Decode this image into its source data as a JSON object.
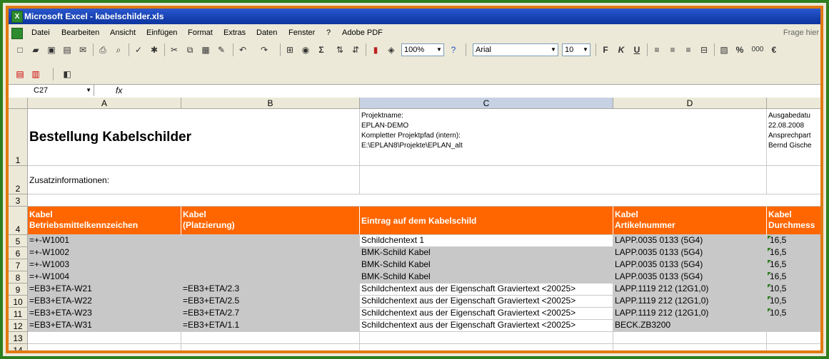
{
  "window": {
    "title": "Microsoft Excel - kabelschilder.xls",
    "app_icon": "X"
  },
  "menu": {
    "items": [
      "Datei",
      "Bearbeiten",
      "Ansicht",
      "Einfügen",
      "Format",
      "Extras",
      "Daten",
      "Fenster",
      "?",
      "Adobe PDF"
    ],
    "ask_placeholder": "Frage hier"
  },
  "toolbar": {
    "zoom": "100%",
    "font": "Arial",
    "size": "10",
    "bold": "F",
    "italic": "K",
    "underline": "U",
    "percent": "%",
    "thousands": "000",
    "euro": "€",
    "sum": "Σ"
  },
  "formula_bar": {
    "name_box": "C27",
    "fx": "fx"
  },
  "columns": [
    "A",
    "B",
    "C",
    "D"
  ],
  "rows": [
    "1",
    "2",
    "3",
    "4",
    "5",
    "6",
    "7",
    "8",
    "9",
    "10",
    "11",
    "12",
    "13",
    "14"
  ],
  "sheet": {
    "title": "Bestellung Kabelschilder",
    "project_info": [
      "Projektname:",
      "EPLAN-DEMO",
      "Kompletter Projektpfad (intern):",
      "E:\\EPLAN8\\Projekte\\EPLAN_alt"
    ],
    "issue_info": [
      "Ausgabedatu",
      "22.08.2008",
      "Ansprechpart",
      "Bernd Gische"
    ],
    "zusatz_label": "Zusatzinformationen:",
    "headers": {
      "a1": "Kabel",
      "a2": "Betriebsmittelkennzeichen",
      "b1": "Kabel",
      "b2": "(Platzierung)",
      "c1": "Eintrag auf dem Kabelschild",
      "d1": "Kabel",
      "d2": "Artikelnummer",
      "e1": "Kabel",
      "e2": "Durchmess"
    },
    "data_rows": [
      {
        "a": "=+-W1001",
        "b": "",
        "c": "Schildchentext 1",
        "d": "LAPP.0035 0133 (5G4)",
        "e": "16,5"
      },
      {
        "a": "=+-W1002",
        "b": "",
        "c": "BMK-Schild Kabel",
        "d": "LAPP.0035 0133 (5G4)",
        "e": "16,5"
      },
      {
        "a": "=+-W1003",
        "b": "",
        "c": "BMK-Schild Kabel",
        "d": "LAPP.0035 0133 (5G4)",
        "e": "16,5"
      },
      {
        "a": "=+-W1004",
        "b": "",
        "c": "BMK-Schild Kabel",
        "d": "LAPP.0035 0133 (5G4)",
        "e": "16,5"
      },
      {
        "a": "=EB3+ETA-W21",
        "b": "=EB3+ETA/2.3",
        "c": "Schildchentext aus der Eigenschaft Graviertext <20025>",
        "d": "LAPP.1119 212 (12G1,0)",
        "e": "10,5"
      },
      {
        "a": "=EB3+ETA-W22",
        "b": "=EB3+ETA/2.5",
        "c": "Schildchentext aus der Eigenschaft Graviertext <20025>",
        "d": "LAPP.1119 212 (12G1,0)",
        "e": "10,5"
      },
      {
        "a": "=EB3+ETA-W23",
        "b": "=EB3+ETA/2.7",
        "c": "Schildchentext aus der Eigenschaft Graviertext <20025>",
        "d": "LAPP.1119 212 (12G1,0)",
        "e": "10,5"
      },
      {
        "a": "=EB3+ETA-W31",
        "b": "=EB3+ETA/1.1",
        "c": "Schildchentext aus der Eigenschaft Graviertext <20025>",
        "d": "BECK.ZB3200",
        "e": ""
      }
    ]
  },
  "colors": {
    "header_orange": "#ff6600",
    "row_gray": "#c8c8c8",
    "title_blue": "#1641b0"
  }
}
